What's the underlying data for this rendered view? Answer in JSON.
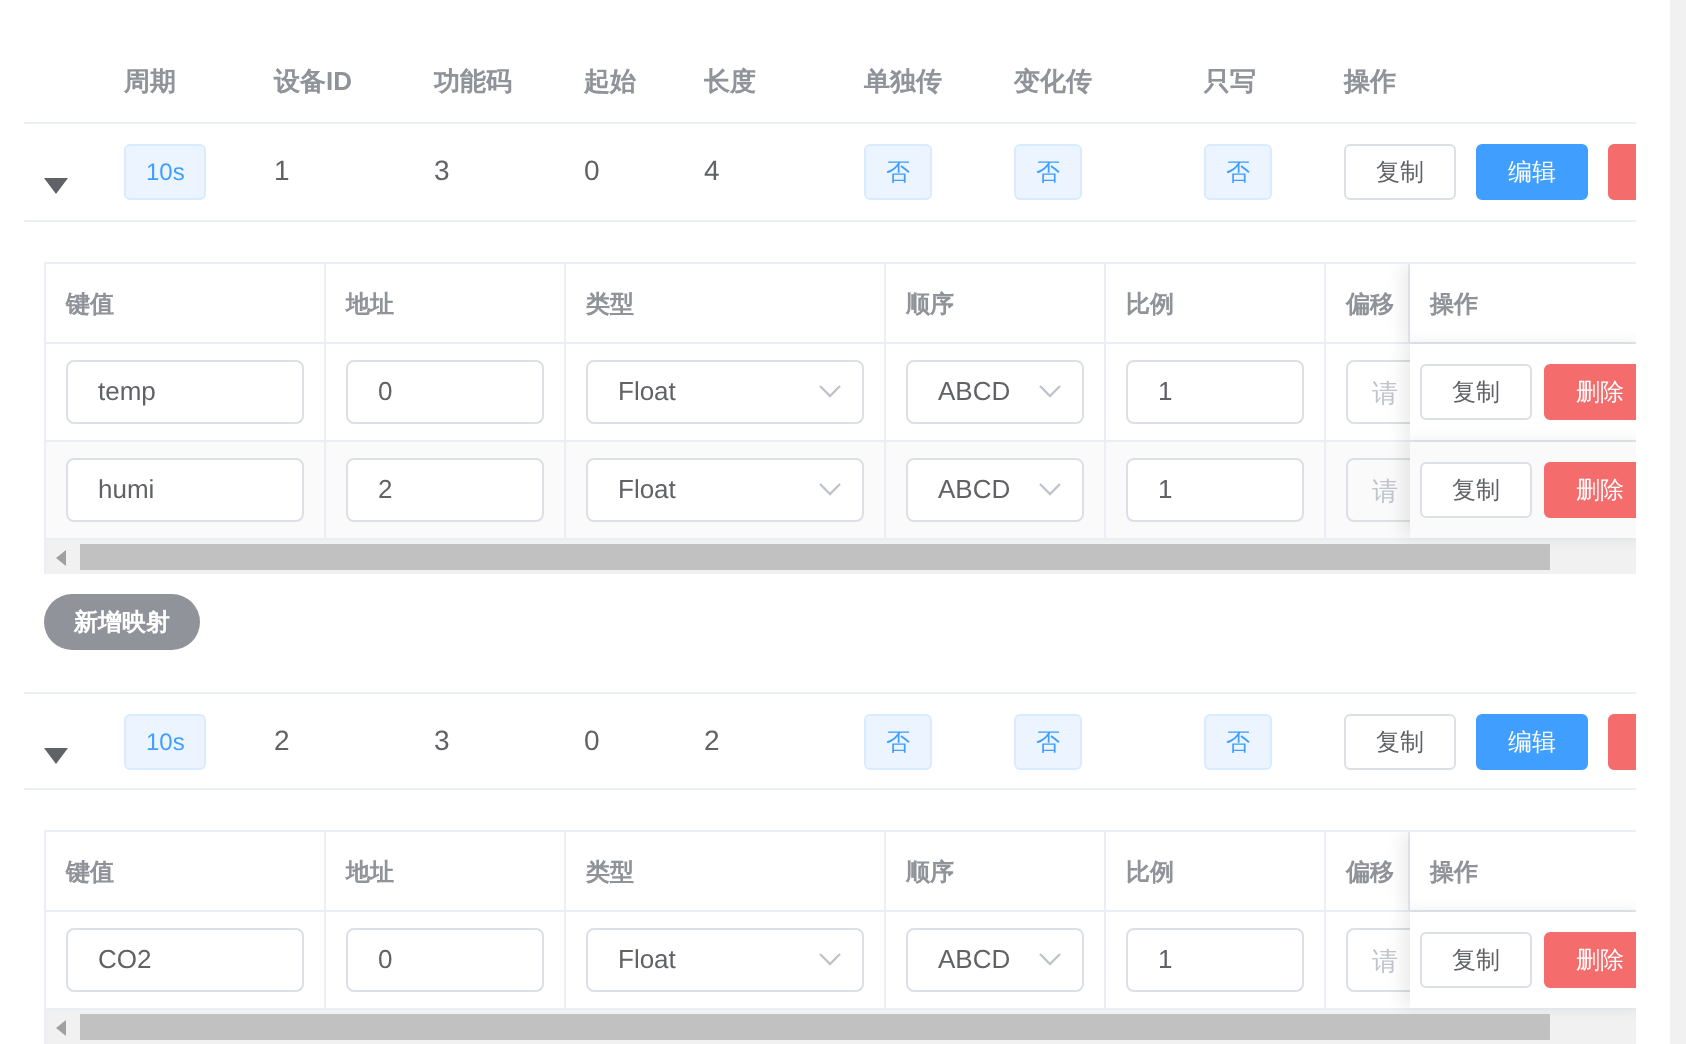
{
  "table": {
    "columns": [
      "周期",
      "设备ID",
      "功能码",
      "起始",
      "长度",
      "单独传",
      "变化传",
      "只写",
      "操作"
    ],
    "rows": [
      {
        "expanded": true,
        "period": "10s",
        "device_id": "1",
        "function_code": "3",
        "start": "0",
        "length": "4",
        "single": "否",
        "change": "否",
        "write_only": "否",
        "actions": [
          {
            "label": "复制",
            "kind": "default"
          },
          {
            "label": "编辑",
            "kind": "primary"
          },
          {
            "kind": "danger"
          }
        ],
        "mappings": {
          "columns": [
            "键值",
            "地址",
            "类型",
            "顺序",
            "比例",
            "偏移",
            "操作"
          ],
          "rows": [
            {
              "key": "temp",
              "address": "0",
              "type": "Float",
              "order": "ABCD",
              "scale": "1",
              "offset_placeholder": "请",
              "actions": [
                {
                  "label": "复制",
                  "kind": "default"
                },
                {
                  "label": "删除",
                  "kind": "danger"
                }
              ]
            },
            {
              "key": "humi",
              "address": "2",
              "type": "Float",
              "order": "ABCD",
              "scale": "1",
              "offset_placeholder": "请",
              "actions": [
                {
                  "label": "复制",
                  "kind": "default"
                },
                {
                  "label": "删除",
                  "kind": "danger"
                }
              ]
            }
          ]
        },
        "add_button": "新增映射"
      },
      {
        "expanded": true,
        "period": "10s",
        "device_id": "2",
        "function_code": "3",
        "start": "0",
        "length": "2",
        "single": "否",
        "change": "否",
        "write_only": "否",
        "actions": [
          {
            "label": "复制",
            "kind": "default"
          },
          {
            "label": "编辑",
            "kind": "primary"
          },
          {
            "kind": "danger"
          }
        ],
        "mappings": {
          "columns": [
            "键值",
            "地址",
            "类型",
            "顺序",
            "比例",
            "偏移",
            "操作"
          ],
          "rows": [
            {
              "key": "CO2",
              "address": "0",
              "type": "Float",
              "order": "ABCD",
              "scale": "1",
              "offset_placeholder": "请",
              "actions": [
                {
                  "label": "复制",
                  "kind": "default"
                },
                {
                  "label": "删除",
                  "kind": "danger"
                }
              ]
            }
          ]
        }
      }
    ]
  }
}
